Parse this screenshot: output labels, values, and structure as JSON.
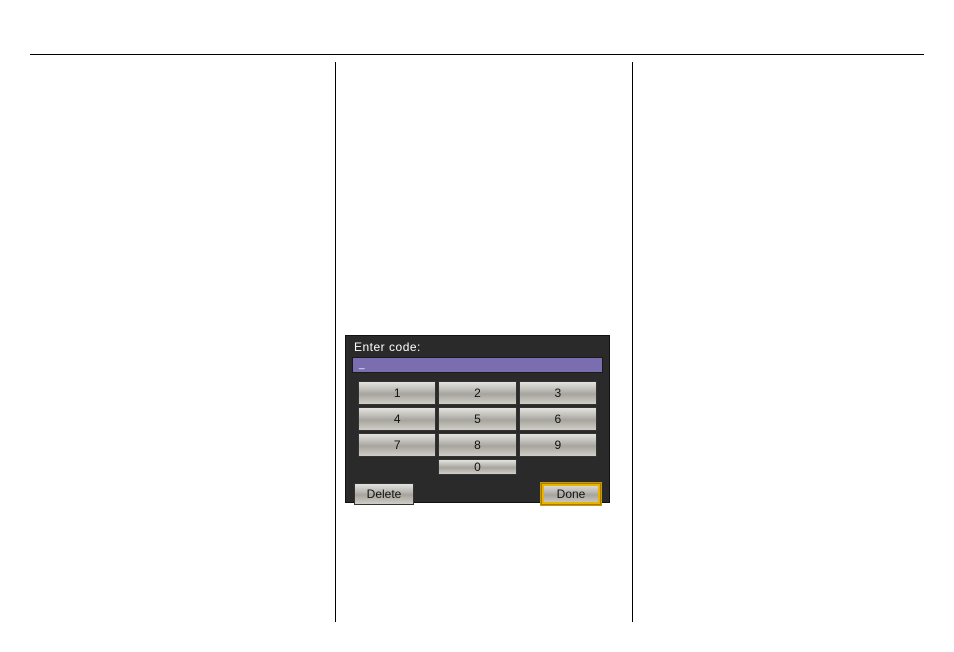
{
  "keypad": {
    "prompt": "Enter code:",
    "input_value": "_",
    "keys": {
      "k1": "1",
      "k2": "2",
      "k3": "3",
      "k4": "4",
      "k5": "5",
      "k6": "6",
      "k7": "7",
      "k8": "8",
      "k9": "9",
      "k0": "0"
    },
    "delete_label": "Delete",
    "done_label": "Done"
  }
}
